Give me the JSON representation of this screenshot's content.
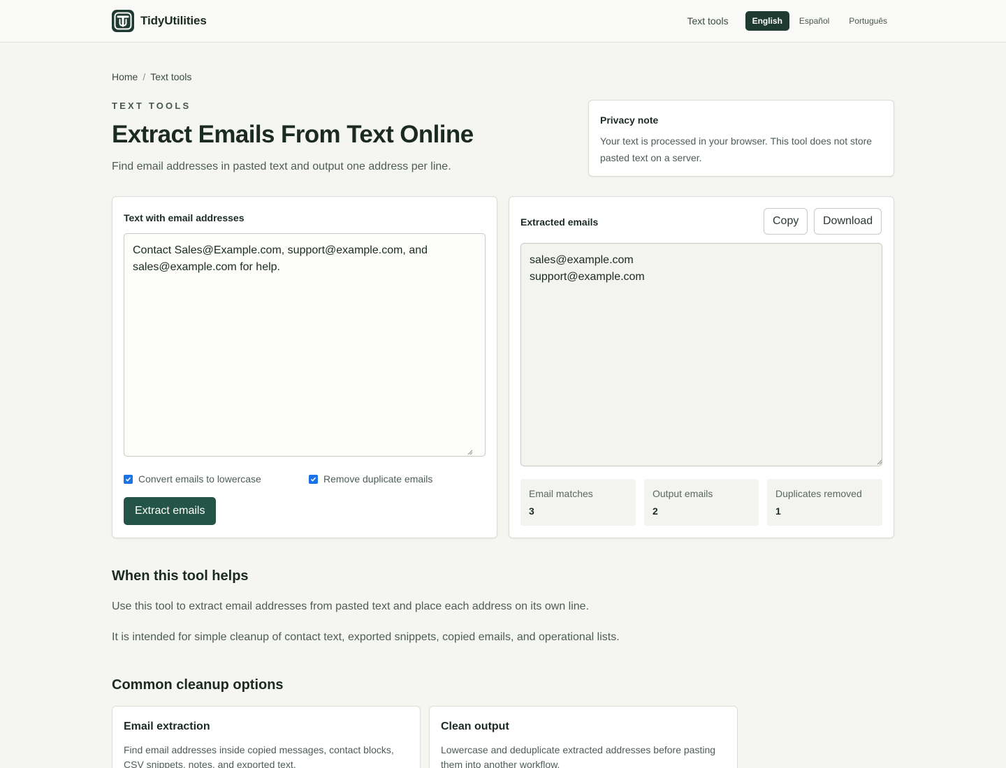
{
  "header": {
    "brand": "TidyUtilities",
    "nav_link": "Text tools",
    "languages": [
      "English",
      "Español",
      "Português"
    ],
    "active_language": "English"
  },
  "breadcrumb": {
    "home": "Home",
    "separator": "/",
    "current": "Text tools"
  },
  "hero": {
    "eyebrow": "TEXT TOOLS",
    "title": "Extract Emails From Text Online",
    "subtitle": "Find email addresses in pasted text and output one address per line."
  },
  "privacy": {
    "title": "Privacy note",
    "body": "Your text is processed in your browser. This tool does not store pasted text on a server."
  },
  "input_panel": {
    "label": "Text with email addresses",
    "value": "Contact Sales@Example.com, support@example.com, and sales@example.com for help.",
    "options": [
      {
        "label": "Convert emails to lowercase",
        "checked": true
      },
      {
        "label": "Remove duplicate emails",
        "checked": true
      }
    ],
    "submit_label": "Extract emails"
  },
  "output_panel": {
    "label": "Extracted emails",
    "copy_label": "Copy",
    "download_label": "Download",
    "value": "sales@example.com\nsupport@example.com",
    "stats": [
      {
        "label": "Email matches",
        "value": "3"
      },
      {
        "label": "Output emails",
        "value": "2"
      },
      {
        "label": "Duplicates removed",
        "value": "1"
      }
    ]
  },
  "help": {
    "heading": "When this tool helps",
    "paragraphs": [
      "Use this tool to extract email addresses from pasted text and place each address on its own line.",
      "It is intended for simple cleanup of contact text, exported snippets, copied emails, and operational lists."
    ]
  },
  "options_section": {
    "heading": "Common cleanup options",
    "cards": [
      {
        "title": "Email extraction",
        "body": "Find email addresses inside copied messages, contact blocks, CSV snippets, notes, and exported text."
      },
      {
        "title": "Clean output",
        "body": "Lowercase and deduplicate extracted addresses before pasting them into another workflow."
      }
    ]
  },
  "colors": {
    "accent": "#235446",
    "brand_dark": "#1f3a31",
    "background": "#f5f5f2",
    "checkbox": "#1a73e8"
  }
}
